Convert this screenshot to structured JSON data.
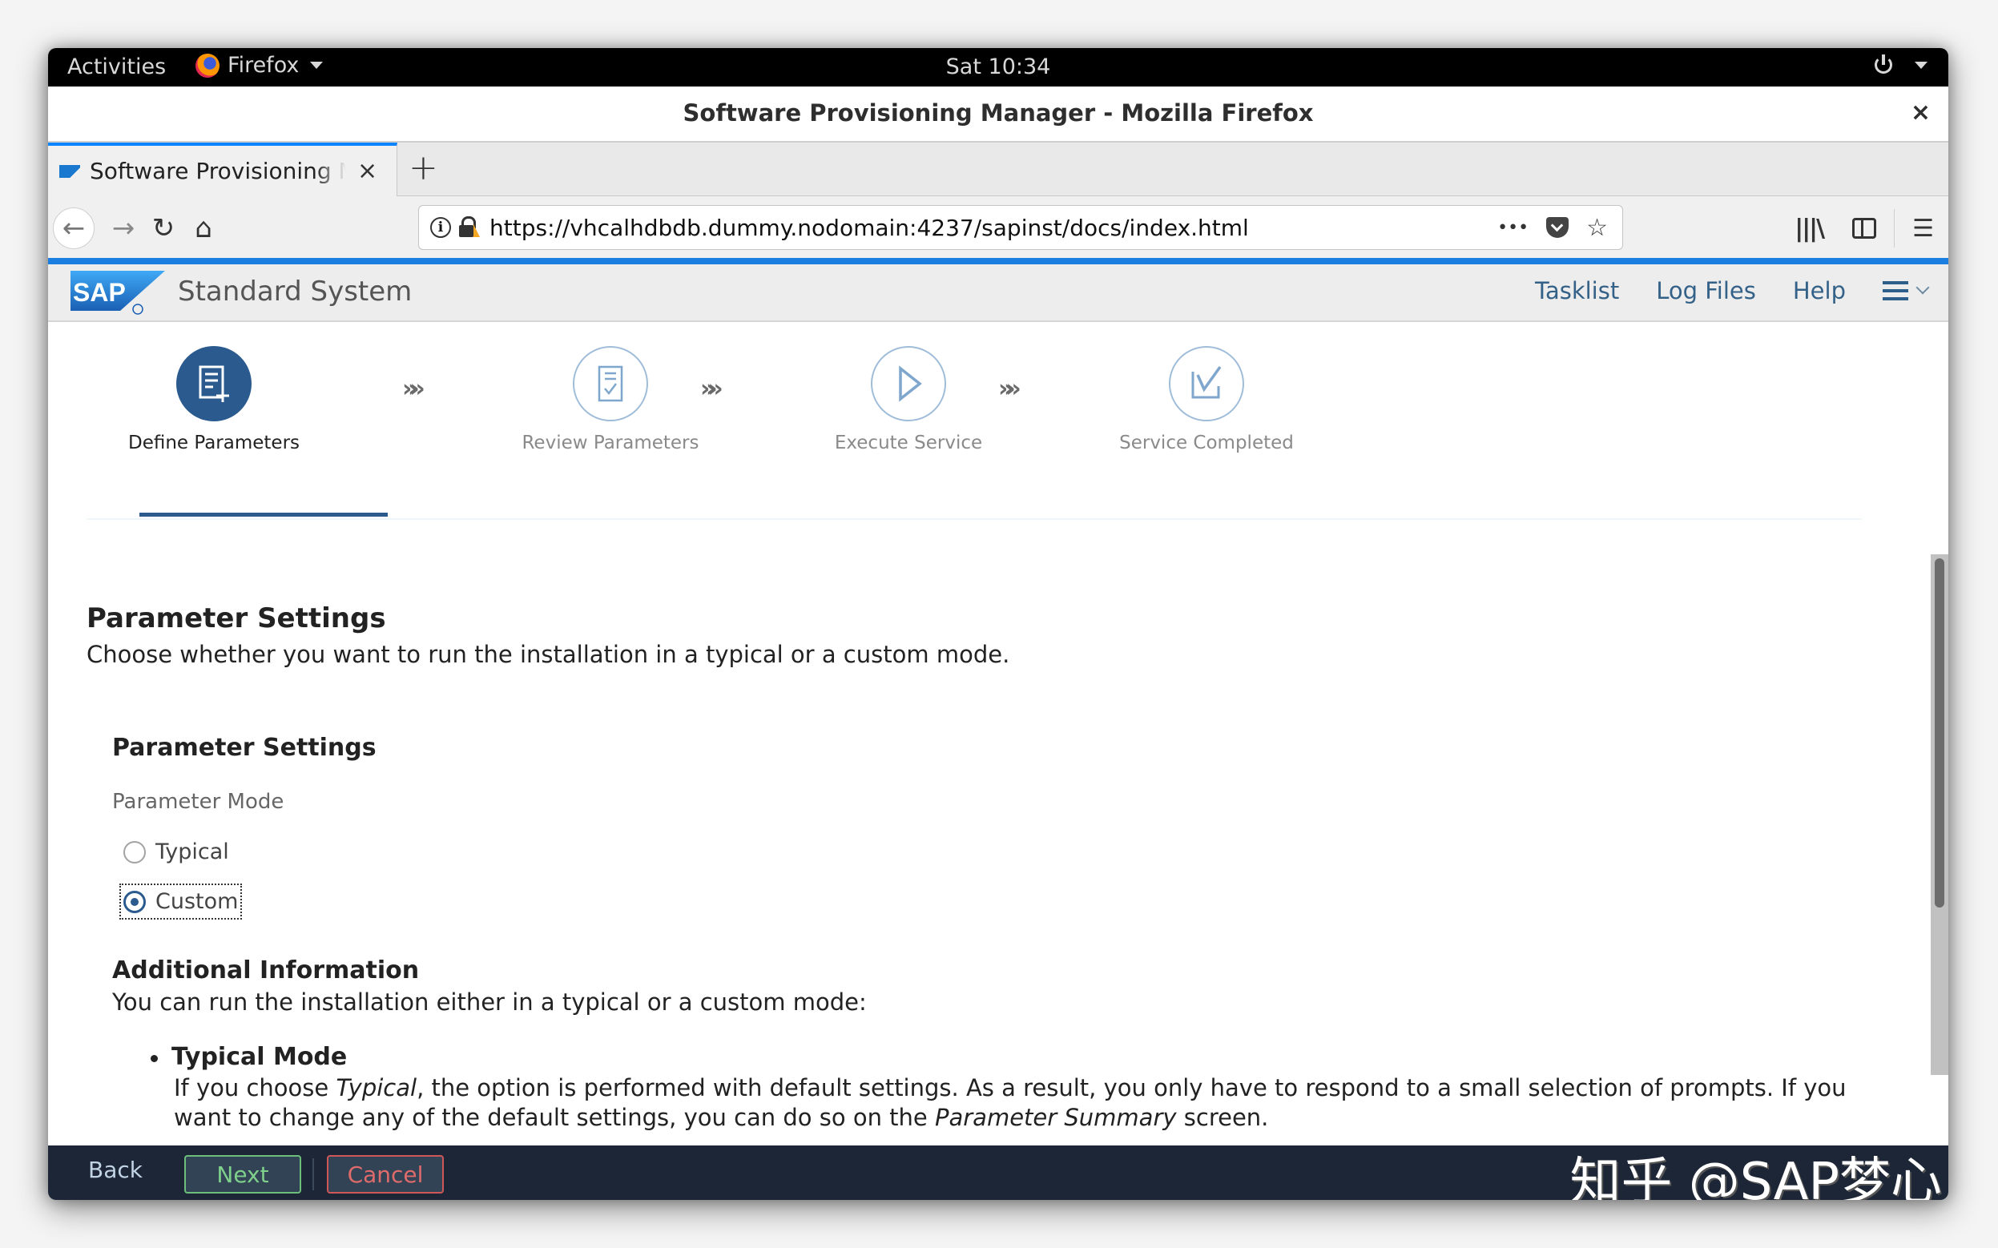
{
  "gnome": {
    "activities": "Activities",
    "app_name": "Firefox",
    "clock": "Sat 10:34"
  },
  "window": {
    "title": "Software Provisioning Manager - Mozilla Firefox",
    "close_label": "×"
  },
  "browser": {
    "tab_title": "Software Provisioning Manager",
    "tab_close": "×",
    "new_tab": "+",
    "url": "https://vhcalhdbdb.dummy.nodomain:4237/sapinst/docs/index.html",
    "page_actions": "•••",
    "icons": [
      "back-arrow",
      "forward-arrow",
      "reload",
      "home",
      "info",
      "insecure-lock",
      "page-actions",
      "pocket",
      "bookmark-star",
      "library",
      "sidebar",
      "menu"
    ]
  },
  "sap": {
    "logo": "SAP",
    "title": "Standard System",
    "links": [
      "Tasklist",
      "Log Files",
      "Help"
    ]
  },
  "stepper": {
    "steps": [
      {
        "label": "Define Parameters",
        "state": "active",
        "icon": "form-add"
      },
      {
        "label": "Review Parameters",
        "state": "pending",
        "icon": "document-check"
      },
      {
        "label": "Execute Service",
        "state": "pending",
        "icon": "play"
      },
      {
        "label": "Service Completed",
        "state": "pending",
        "icon": "checkbox-checked"
      }
    ],
    "separator": "»»"
  },
  "content": {
    "heading": "Parameter Settings",
    "subheading": "Choose whether you want to run the installation in a typical or a custom mode.",
    "section_title": "Parameter Settings",
    "field_label": "Parameter Mode",
    "options": [
      {
        "label": "Typical",
        "checked": false
      },
      {
        "label": "Custom",
        "checked": true
      }
    ],
    "info_title": "Additional Information",
    "info_text": "You can run the installation either in a typical or a custom mode:",
    "bullet_title": "Typical Mode",
    "bullet_text_1": "If you choose ",
    "bullet_italic_1": "Typical",
    "bullet_text_2": ", the option is performed with default settings. As a result, you only have to respond to a small selection of prompts. If you want to change any of the default settings, you can do so on the ",
    "bullet_italic_2": "Parameter Summary",
    "bullet_text_3": " screen."
  },
  "footer": {
    "back": "Back",
    "next": "Next",
    "cancel": "Cancel"
  },
  "watermark": "知乎 @SAP梦心",
  "colors": {
    "sap_blue": "#2a5a8e",
    "firefox_accent": "#1a7fe0",
    "footer_bg": "#1c2636",
    "next_green": "#7ed08b",
    "cancel_red": "#e06b6b"
  }
}
